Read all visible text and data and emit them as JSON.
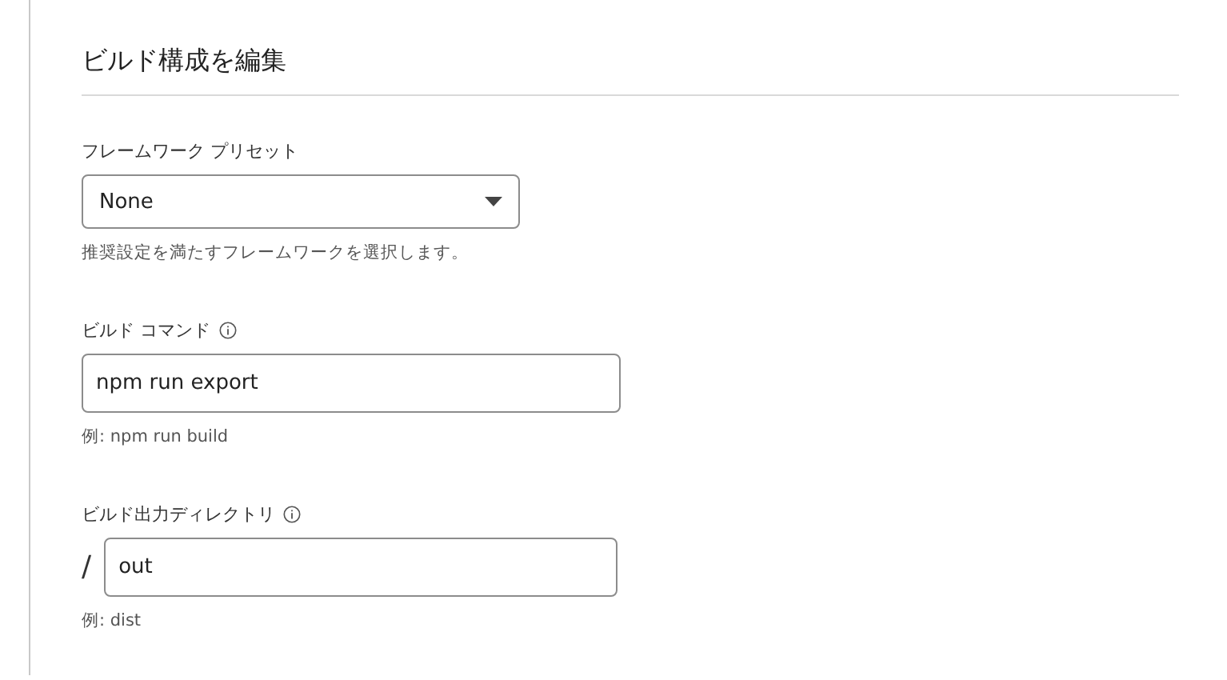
{
  "heading": "ビルド構成を編集",
  "fields": [
    {
      "kind": "select",
      "label": "フレームワーク プリセット",
      "info": false,
      "value": "None",
      "help": "推奨設定を満たすフレームワークを選択します。"
    },
    {
      "kind": "text",
      "label": "ビルド コマンド",
      "info": true,
      "value": "npm run export",
      "help": "例: npm run build"
    },
    {
      "kind": "prefixed",
      "label": "ビルド出力ディレクトリ",
      "info": true,
      "prefix": "/",
      "value": "out",
      "help": "例: dist"
    }
  ]
}
